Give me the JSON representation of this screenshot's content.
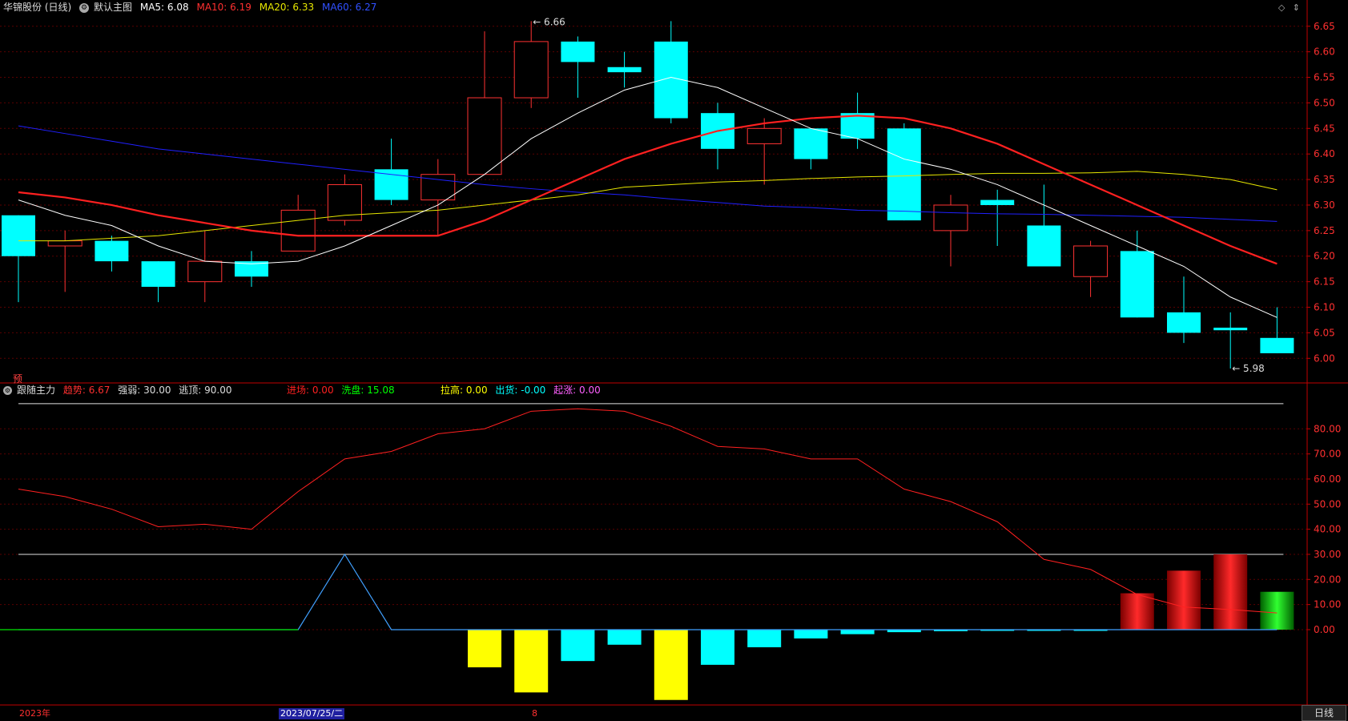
{
  "main_header": {
    "stock_name": "华锦股份 (日线)",
    "template": "默认主图",
    "ma5_label": "MA5: 6.08",
    "ma10_label": "MA10: 6.19",
    "ma20_label": "MA20: 6.33",
    "ma60_label": "MA60: 6.27"
  },
  "indicator_header": {
    "name": "跟随主力",
    "trend_label": "趋势: 6.67",
    "strong_label": "强弱: 30.00",
    "escape_label": "逃顶: 90.00",
    "entry_label": "进场: 0.00",
    "wash_label": "洗盘: 15.08",
    "lift_label": "拉高: 0.00",
    "ship_label": "出货: -0.00",
    "rise_label": "起涨: 0.00"
  },
  "pre_marker": "预",
  "bottom_bar": {
    "year_label": "2023年",
    "date_label": "2023/07/25/二",
    "month_label": "8",
    "period_label": "日线"
  },
  "colors": {
    "up": "#ff3232",
    "down": "#00ffff",
    "ma5": "#ffffff",
    "ma10": "#ff2020",
    "ma20": "#e6e600",
    "ma60": "#2020ff",
    "grid": "#5a0000",
    "axis": "#c00000"
  },
  "chart_data": [
    {
      "type": "candlestick",
      "y_ticks": [
        "6.65",
        "6.60",
        "6.55",
        "6.50",
        "6.45",
        "6.40",
        "6.35",
        "6.30",
        "6.25",
        "6.20",
        "6.15",
        "6.10",
        "6.05",
        "6.00"
      ],
      "ylim": [
        5.955,
        6.67
      ],
      "candles": [
        {
          "o": 6.28,
          "c": 6.2,
          "h": 6.28,
          "l": 6.11
        },
        {
          "o": 6.22,
          "c": 6.23,
          "h": 6.25,
          "l": 6.13
        },
        {
          "o": 6.23,
          "c": 6.19,
          "h": 6.24,
          "l": 6.17
        },
        {
          "o": 6.19,
          "c": 6.14,
          "h": 6.19,
          "l": 6.11
        },
        {
          "o": 6.15,
          "c": 6.19,
          "h": 6.25,
          "l": 6.11
        },
        {
          "o": 6.19,
          "c": 6.16,
          "h": 6.21,
          "l": 6.14
        },
        {
          "o": 6.21,
          "c": 6.29,
          "h": 6.32,
          "l": 6.21
        },
        {
          "o": 6.27,
          "c": 6.34,
          "h": 6.36,
          "l": 6.26
        },
        {
          "o": 6.37,
          "c": 6.31,
          "h": 6.43,
          "l": 6.3
        },
        {
          "o": 6.31,
          "c": 6.36,
          "h": 6.39,
          "l": 6.24
        },
        {
          "o": 6.36,
          "c": 6.51,
          "h": 6.64,
          "l": 6.36
        },
        {
          "o": 6.51,
          "c": 6.62,
          "h": 6.66,
          "l": 6.49
        },
        {
          "o": 6.62,
          "c": 6.58,
          "h": 6.63,
          "l": 6.51
        },
        {
          "o": 6.57,
          "c": 6.56,
          "h": 6.6,
          "l": 6.53
        },
        {
          "o": 6.62,
          "c": 6.47,
          "h": 6.66,
          "l": 6.46
        },
        {
          "o": 6.48,
          "c": 6.41,
          "h": 6.5,
          "l": 6.37
        },
        {
          "o": 6.42,
          "c": 6.45,
          "h": 6.47,
          "l": 6.34
        },
        {
          "o": 6.45,
          "c": 6.39,
          "h": 6.45,
          "l": 6.37
        },
        {
          "o": 6.48,
          "c": 6.43,
          "h": 6.52,
          "l": 6.41
        },
        {
          "o": 6.45,
          "c": 6.27,
          "h": 6.46,
          "l": 6.27
        },
        {
          "o": 6.25,
          "c": 6.3,
          "h": 6.32,
          "l": 6.18
        },
        {
          "o": 6.31,
          "c": 6.3,
          "h": 6.33,
          "l": 6.22
        },
        {
          "o": 6.26,
          "c": 6.18,
          "h": 6.34,
          "l": 6.18
        },
        {
          "o": 6.16,
          "c": 6.22,
          "h": 6.23,
          "l": 6.12
        },
        {
          "o": 6.21,
          "c": 6.08,
          "h": 6.25,
          "l": 6.08
        },
        {
          "o": 6.09,
          "c": 6.05,
          "h": 6.16,
          "l": 6.03
        },
        {
          "o": 6.06,
          "c": 6.055,
          "h": 6.09,
          "l": 5.98
        },
        {
          "o": 6.04,
          "c": 6.01,
          "h": 6.1,
          "l": 6.01
        }
      ],
      "ma5": [
        6.31,
        6.28,
        6.26,
        6.22,
        6.19,
        6.185,
        6.19,
        6.22,
        6.26,
        6.3,
        6.36,
        6.43,
        6.48,
        6.525,
        6.55,
        6.53,
        6.49,
        6.45,
        6.43,
        6.39,
        6.37,
        6.34,
        6.3,
        6.26,
        6.22,
        6.18,
        6.12,
        6.08
      ],
      "ma10": [
        6.325,
        6.315,
        6.3,
        6.28,
        6.265,
        6.25,
        6.24,
        6.24,
        6.24,
        6.24,
        6.27,
        6.31,
        6.35,
        6.39,
        6.42,
        6.445,
        6.46,
        6.47,
        6.475,
        6.47,
        6.45,
        6.42,
        6.38,
        6.34,
        6.3,
        6.26,
        6.22,
        6.185
      ],
      "ma20": [
        6.23,
        6.23,
        6.235,
        6.24,
        6.25,
        6.26,
        6.27,
        6.28,
        6.285,
        6.29,
        6.3,
        6.31,
        6.32,
        6.335,
        6.34,
        6.345,
        6.348,
        6.352,
        6.355,
        6.357,
        6.36,
        6.362,
        6.362,
        6.363,
        6.366,
        6.36,
        6.35,
        6.33
      ],
      "ma60": [
        6.455,
        6.44,
        6.425,
        6.41,
        6.4,
        6.39,
        6.38,
        6.37,
        6.36,
        6.35,
        6.34,
        6.332,
        6.325,
        6.32,
        6.312,
        6.305,
        6.298,
        6.295,
        6.29,
        6.288,
        6.285,
        6.283,
        6.282,
        6.28,
        6.278,
        6.276,
        6.272,
        6.268
      ],
      "annotations": [
        {
          "text": "6.66",
          "index": 11
        },
        {
          "text": "5.98",
          "index": 26
        }
      ]
    },
    {
      "type": "indicator",
      "y_ticks": [
        "80.00",
        "70.00",
        "60.00",
        "50.00",
        "40.00",
        "30.00",
        "20.00",
        "10.00",
        "0.00"
      ],
      "ylim": [
        -30,
        97
      ],
      "escape_line": 90,
      "strong_line": 30,
      "trend": [
        56,
        53,
        48,
        41,
        42,
        40,
        55,
        68,
        71,
        78,
        80,
        87,
        88,
        87,
        81,
        73,
        72,
        68,
        68,
        56,
        51,
        43,
        28,
        24,
        14,
        9,
        8,
        6.67
      ],
      "blue_line": [
        0,
        0,
        0,
        0,
        0,
        0,
        0,
        30,
        0,
        0,
        0,
        0,
        0,
        0,
        0,
        0,
        0,
        0,
        0,
        0,
        0,
        0,
        0,
        0,
        0,
        0,
        0,
        0
      ],
      "green_line_segments": [
        [
          0,
          6
        ]
      ],
      "bars": [
        {
          "i": 10,
          "v": -15,
          "c": "yellow"
        },
        {
          "i": 11,
          "v": -25,
          "c": "yellow"
        },
        {
          "i": 12,
          "v": -12.5,
          "c": "cyan"
        },
        {
          "i": 13,
          "v": -6,
          "c": "cyan"
        },
        {
          "i": 14,
          "v": -28,
          "c": "yellow"
        },
        {
          "i": 15,
          "v": -14,
          "c": "cyan"
        },
        {
          "i": 16,
          "v": -7,
          "c": "cyan"
        },
        {
          "i": 17,
          "v": -3.5,
          "c": "cyan"
        },
        {
          "i": 18,
          "v": -1.8,
          "c": "cyan"
        },
        {
          "i": 19,
          "v": -1,
          "c": "cyan"
        },
        {
          "i": 20,
          "v": -0.6,
          "c": "cyan"
        },
        {
          "i": 21,
          "v": -0.4,
          "c": "cyan"
        },
        {
          "i": 22,
          "v": -0.3,
          "c": "cyan"
        },
        {
          "i": 23,
          "v": -0.2,
          "c": "cyan"
        },
        {
          "i": 24,
          "v": 14.5,
          "c": "red"
        },
        {
          "i": 25,
          "v": 23.5,
          "c": "red"
        },
        {
          "i": 26,
          "v": 30,
          "c": "red"
        },
        {
          "i": 27,
          "v": 15.08,
          "c": "green"
        }
      ]
    }
  ]
}
